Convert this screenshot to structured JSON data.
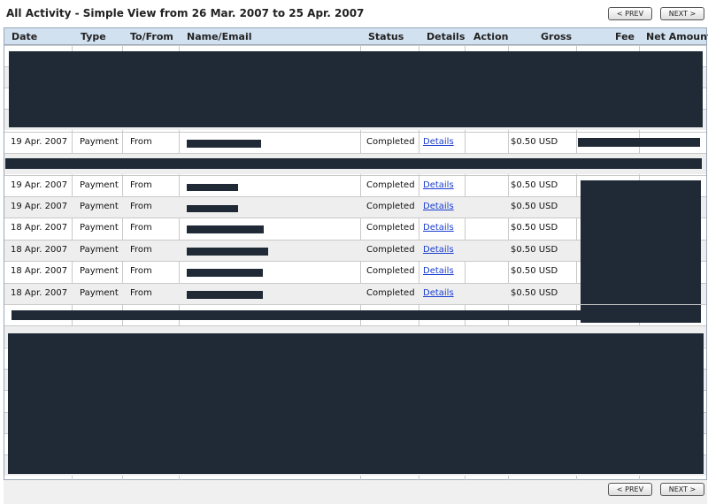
{
  "title": "All Activity - Simple View from 26 Mar. 2007 to 25 Apr. 2007",
  "nav": {
    "prev_label": "< PREV",
    "next_label": "NEXT >"
  },
  "columns": [
    "Date",
    "Type",
    "To/From",
    "Name/Email",
    "Status",
    "Details",
    "Action",
    "Gross",
    "Fee",
    "Net Amount"
  ],
  "rows": [
    {
      "date": "19 Apr. 2007",
      "type": "Payment",
      "tofrom": "From",
      "status": "Completed",
      "details": "Details",
      "gross": "$0.50 USD"
    },
    {
      "date": "19 Apr. 2007",
      "type": "Payment",
      "tofrom": "From",
      "status": "Completed",
      "details": "Details",
      "gross": "$0.50 USD"
    },
    {
      "date": "19 Apr. 2007",
      "type": "Payment",
      "tofrom": "From",
      "status": "Completed",
      "details": "Details",
      "gross": "$0.50 USD"
    },
    {
      "date": "18 Apr. 2007",
      "type": "Payment",
      "tofrom": "From",
      "status": "Completed",
      "details": "Details",
      "gross": "$0.50 USD"
    },
    {
      "date": "18 Apr. 2007",
      "type": "Payment",
      "tofrom": "From",
      "status": "Completed",
      "details": "Details",
      "gross": "$0.50 USD"
    },
    {
      "date": "18 Apr. 2007",
      "type": "Payment",
      "tofrom": "From",
      "status": "Completed",
      "details": "Details",
      "gross": "$0.50 USD"
    },
    {
      "date": "18 Apr. 2007",
      "type": "Payment",
      "tofrom": "From",
      "status": "Completed",
      "details": "Details",
      "gross": "$0.50 USD"
    }
  ],
  "colors": {
    "header_bg": "#d2e1f0",
    "redaction": "#1f2a36",
    "link": "#1a3ecf",
    "alt_row": "#eeeeee"
  }
}
